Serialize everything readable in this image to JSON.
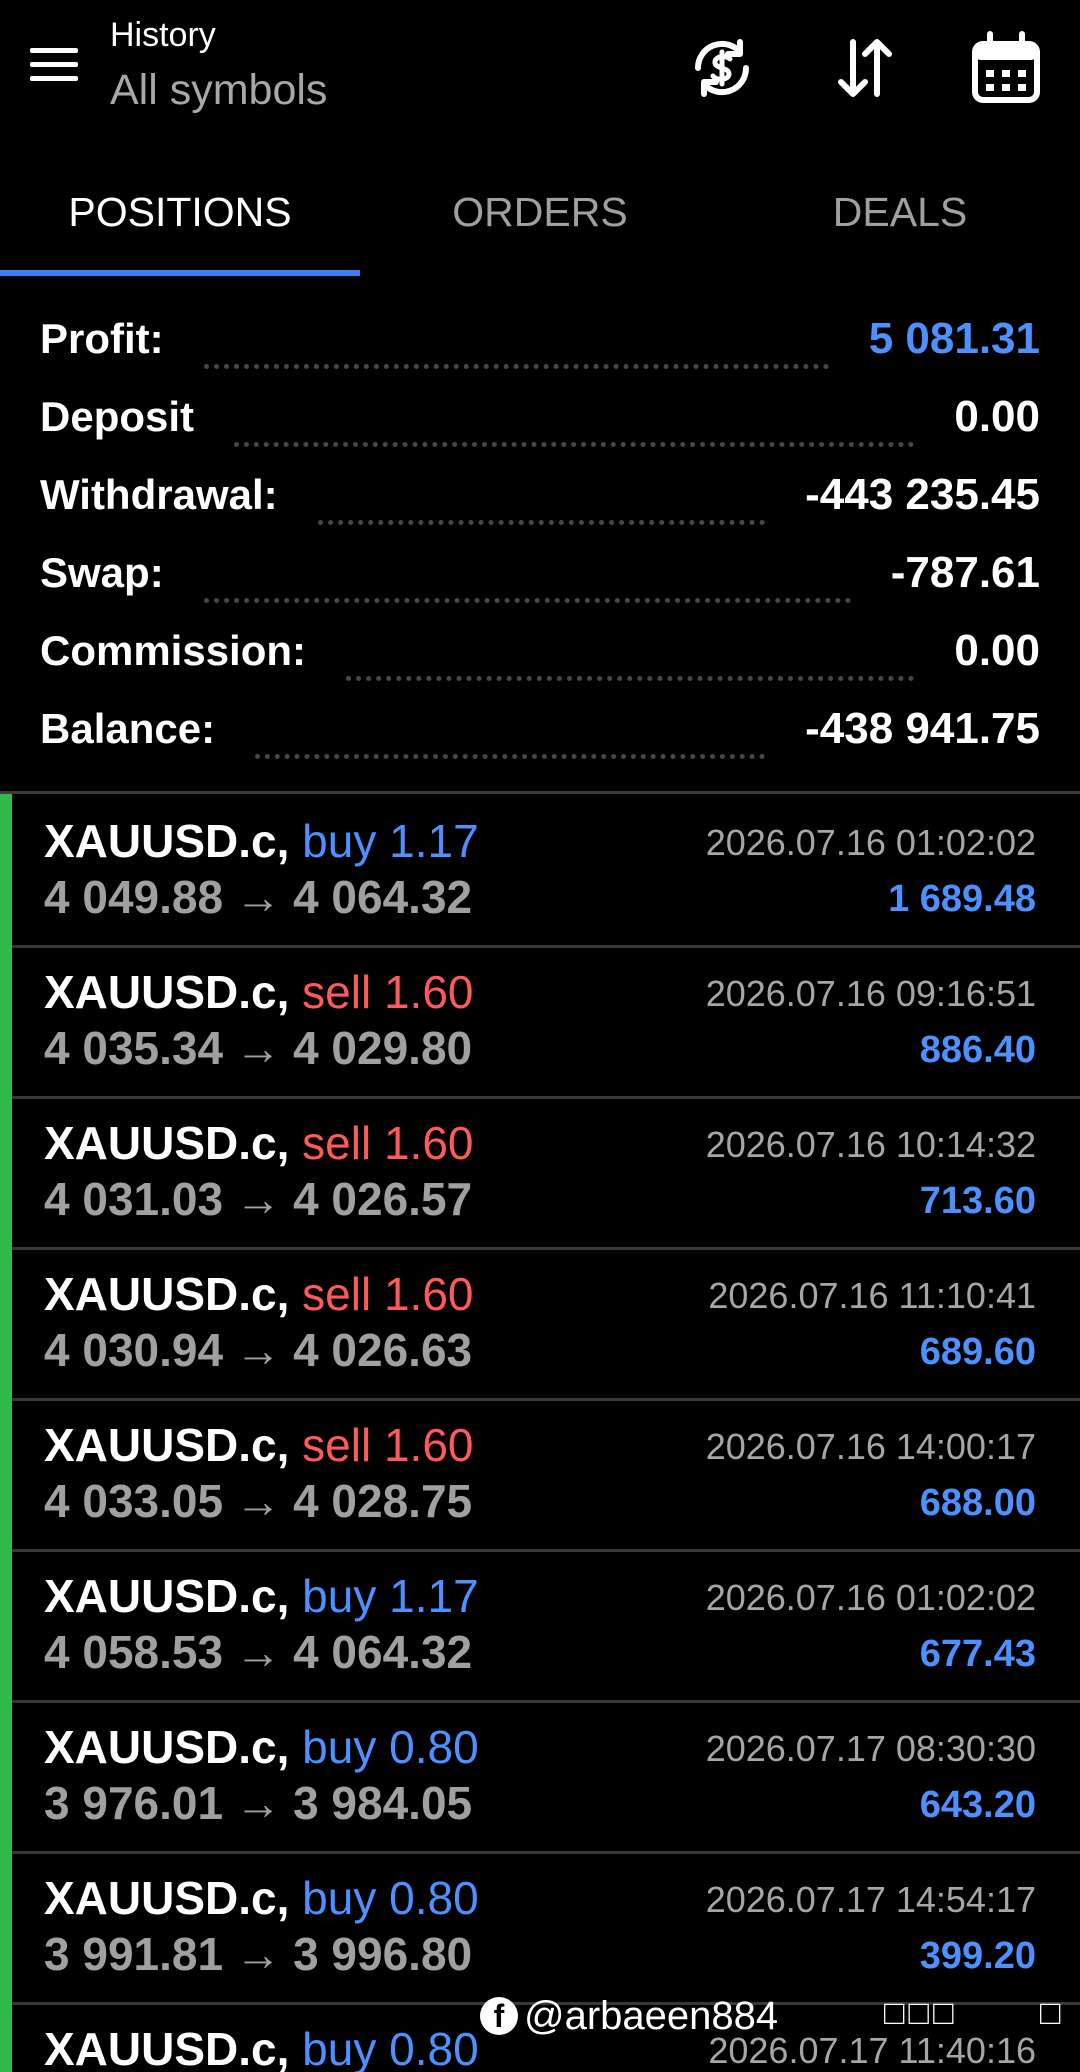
{
  "header": {
    "title": "History",
    "subtitle": "All symbols",
    "icons": [
      "menu-icon",
      "currency-sync-icon",
      "sort-icon",
      "calendar-icon"
    ]
  },
  "tabs": [
    {
      "label": "POSITIONS",
      "active": true
    },
    {
      "label": "ORDERS",
      "active": false
    },
    {
      "label": "DEALS",
      "active": false
    }
  ],
  "summary": {
    "profit": {
      "label": "Profit:",
      "value": "5 081.31"
    },
    "deposit": {
      "label": "Deposit",
      "value": "0.00"
    },
    "withdrawal": {
      "label": "Withdrawal:",
      "value": "-443 235.45"
    },
    "swap": {
      "label": "Swap:",
      "value": "-787.61"
    },
    "commission": {
      "label": "Commission:",
      "value": "0.00"
    },
    "balance": {
      "label": "Balance:",
      "value": "-438 941.75"
    }
  },
  "positions": [
    {
      "symbol": "XAUUSD.c,",
      "side": "buy 1.17",
      "type": "buy",
      "open": "4 049.88",
      "close": "4 064.32",
      "time": "2026.07.16 01:02:02",
      "profit": "1 689.48"
    },
    {
      "symbol": "XAUUSD.c,",
      "side": "sell 1.60",
      "type": "sell",
      "open": "4 035.34",
      "close": "4 029.80",
      "time": "2026.07.16 09:16:51",
      "profit": "886.40"
    },
    {
      "symbol": "XAUUSD.c,",
      "side": "sell 1.60",
      "type": "sell",
      "open": "4 031.03",
      "close": "4 026.57",
      "time": "2026.07.16 10:14:32",
      "profit": "713.60"
    },
    {
      "symbol": "XAUUSD.c,",
      "side": "sell 1.60",
      "type": "sell",
      "open": "4 030.94",
      "close": "4 026.63",
      "time": "2026.07.16 11:10:41",
      "profit": "689.60"
    },
    {
      "symbol": "XAUUSD.c,",
      "side": "sell 1.60",
      "type": "sell",
      "open": "4 033.05",
      "close": "4 028.75",
      "time": "2026.07.16 14:00:17",
      "profit": "688.00"
    },
    {
      "symbol": "XAUUSD.c,",
      "side": "buy 1.17",
      "type": "buy",
      "open": "4 058.53",
      "close": "4 064.32",
      "time": "2026.07.16 01:02:02",
      "profit": "677.43"
    },
    {
      "symbol": "XAUUSD.c,",
      "side": "buy 0.80",
      "type": "buy",
      "open": "3 976.01",
      "close": "3 984.05",
      "time": "2026.07.17 08:30:30",
      "profit": "643.20"
    },
    {
      "symbol": "XAUUSD.c,",
      "side": "buy 0.80",
      "type": "buy",
      "open": "3 991.81",
      "close": "3 996.80",
      "time": "2026.07.17 14:54:17",
      "profit": "399.20"
    },
    {
      "symbol": "XAUUSD.c,",
      "side": "buy 0.80",
      "type": "buy",
      "open": "",
      "close": "",
      "time": "2026.07.17 11:40:16",
      "profit": ""
    }
  ],
  "arrow": "→",
  "watermark": {
    "text": "@arbaeen884",
    "extra": "□□□",
    "extra2": "□"
  },
  "colors": {
    "accent": "#3e7df0",
    "profit_blue": "#4d90ff",
    "sell_red": "#ff5a5a",
    "bar_green": "#33b94a"
  }
}
